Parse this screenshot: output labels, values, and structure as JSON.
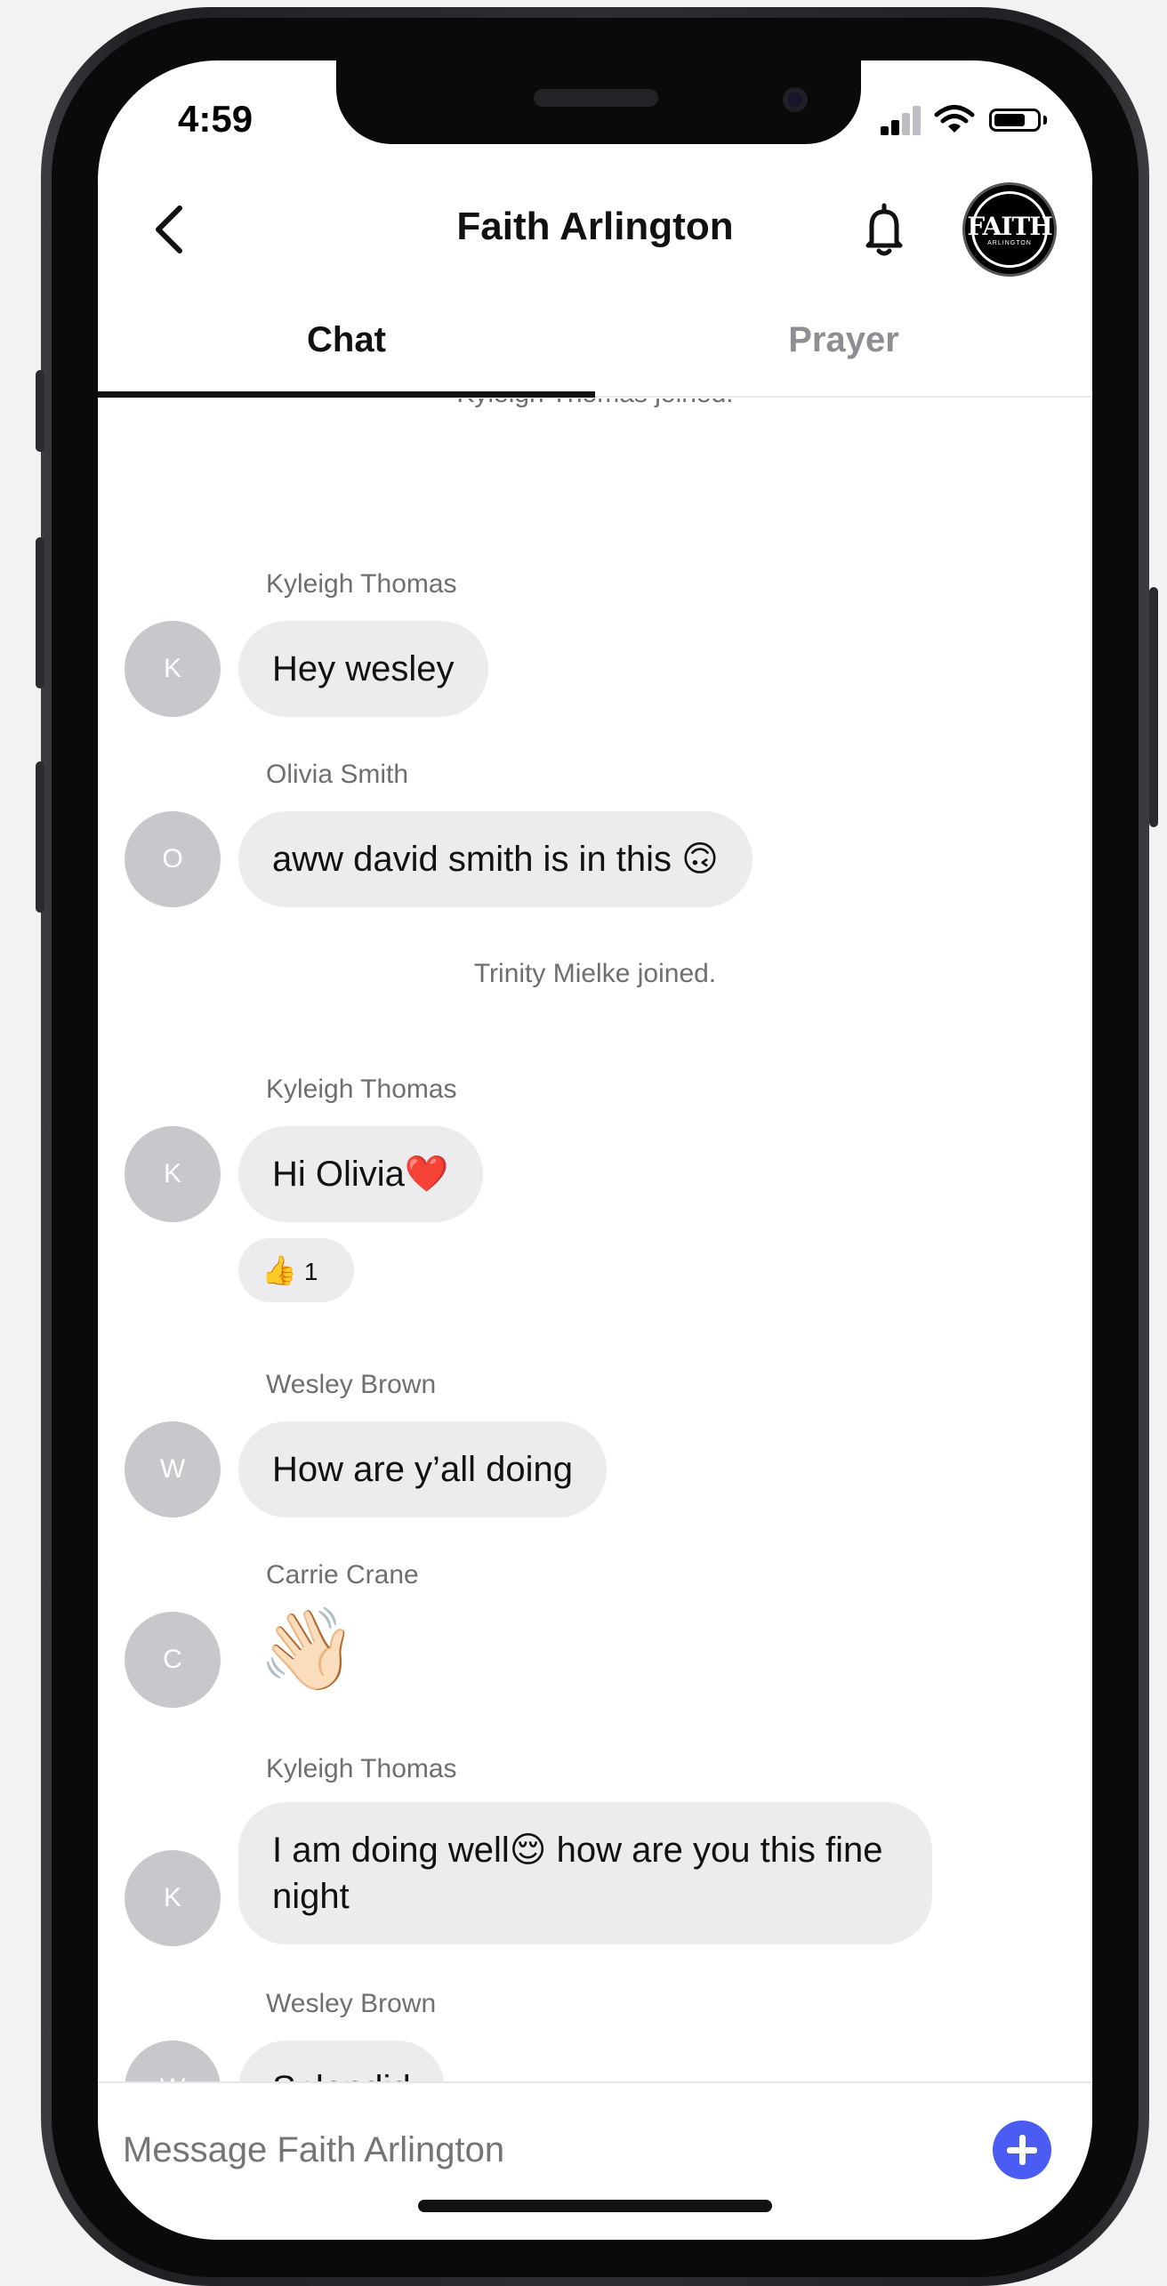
{
  "status": {
    "time": "4:59"
  },
  "header": {
    "title": "Faith Arlington",
    "logo_text": "FAITH",
    "logo_subtext": "ARLINGTON"
  },
  "tabs": [
    {
      "label": "Chat"
    },
    {
      "label": "Prayer"
    }
  ],
  "messages": {
    "sys1": "Kyleigh Thomas joined.",
    "m1": {
      "sender": "Kyleigh Thomas",
      "initial": "K",
      "text": "Hey wesley"
    },
    "m2": {
      "sender": "Olivia Smith",
      "initial": "O",
      "text": "aww david smith is in this 🙃"
    },
    "sys2": "Trinity Mielke joined.",
    "m3": {
      "sender": "Kyleigh Thomas",
      "initial": "K",
      "text": "Hi Olivia❤️",
      "reaction_emoji": "👍",
      "reaction_count": "1"
    },
    "m4": {
      "sender": "Wesley Brown",
      "initial": "W",
      "text": "How are y’all doing"
    },
    "m5": {
      "sender": "Carrie Crane",
      "initial": "C",
      "text": "👋🏻"
    },
    "m6": {
      "sender": "Kyleigh Thomas",
      "initial": "K",
      "text": "I am doing well😌  how are you this fine night"
    },
    "m7": {
      "sender": "Wesley Brown",
      "initial": "W",
      "text": "Splendid"
    }
  },
  "composer": {
    "placeholder": "Message Faith Arlington"
  },
  "colors": {
    "accent": "#4a5cf2",
    "bubble": "#ececef",
    "avatar": "#c7c8cc"
  },
  "icons": [
    "back-chevron-icon",
    "bell-icon",
    "plus-icon",
    "signal-icon",
    "wifi-icon",
    "battery-icon"
  ]
}
